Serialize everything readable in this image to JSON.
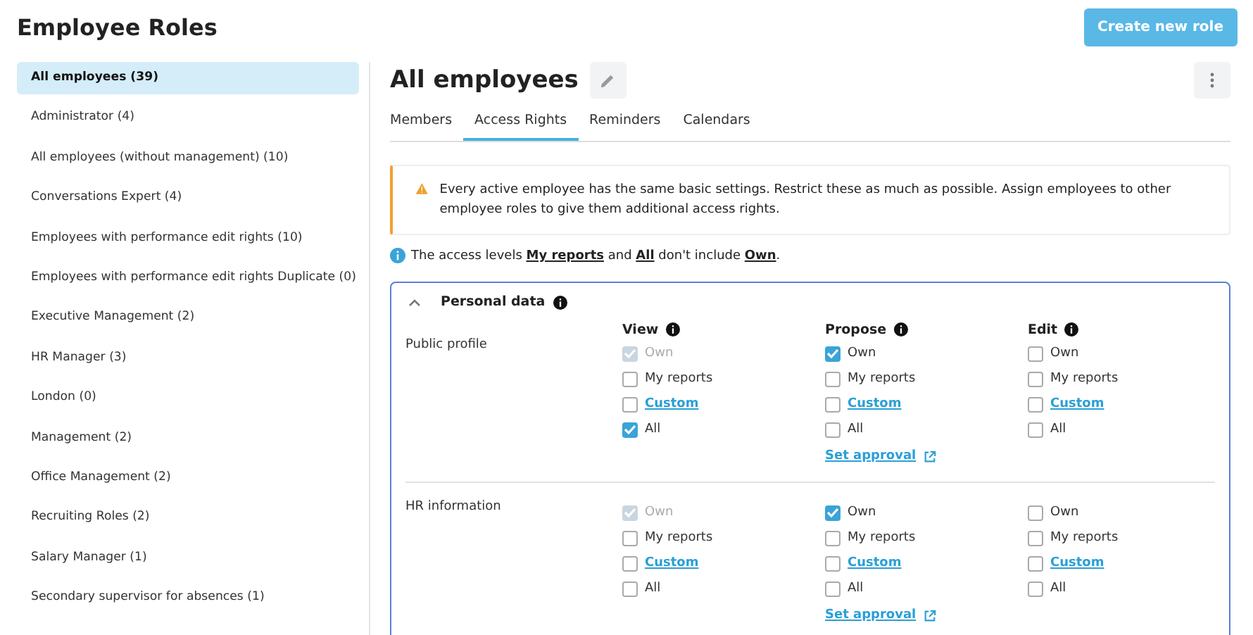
{
  "page_title": "Employee Roles",
  "create_button": "Create new role",
  "sidebar": {
    "items": [
      {
        "label": "All employees (39)",
        "selected": true
      },
      {
        "label": "Administrator (4)",
        "selected": false
      },
      {
        "label": "All employees (without management) (10)",
        "selected": false
      },
      {
        "label": "Conversations Expert (4)",
        "selected": false
      },
      {
        "label": "Employees with performance edit rights (10)",
        "selected": false
      },
      {
        "label": "Employees with performance edit rights Duplicate (0)",
        "selected": false
      },
      {
        "label": "Executive Management (2)",
        "selected": false
      },
      {
        "label": "HR Manager (3)",
        "selected": false
      },
      {
        "label": "London (0)",
        "selected": false
      },
      {
        "label": "Management (2)",
        "selected": false
      },
      {
        "label": "Office Management (2)",
        "selected": false
      },
      {
        "label": "Recruiting Roles (2)",
        "selected": false
      },
      {
        "label": "Salary Manager (1)",
        "selected": false
      },
      {
        "label": "Secondary supervisor for absences (1)",
        "selected": false
      }
    ]
  },
  "role": {
    "title": "All employees"
  },
  "tabs": [
    {
      "label": "Members",
      "selected": false
    },
    {
      "label": "Access Rights",
      "selected": true
    },
    {
      "label": "Reminders",
      "selected": false
    },
    {
      "label": "Calendars",
      "selected": false
    }
  ],
  "warning": "Every active employee has the same basic settings. Restrict these as much as possible. Assign employees to other employee roles to give them additional access rights.",
  "info": "The access levels **My reports** and **All** don't include **Own**.",
  "section": {
    "title": "Personal data",
    "expanded": true,
    "columns": [
      "View",
      "Propose",
      "Edit"
    ],
    "rows": [
      {
        "label": "Public profile",
        "cells": [
          {
            "options": [
              {
                "label": "Own",
                "kind": "plain",
                "checked": true,
                "disabled": true
              },
              {
                "label": "My reports",
                "kind": "plain",
                "checked": false,
                "disabled": false
              },
              {
                "label": "Custom",
                "kind": "link",
                "checked": false,
                "disabled": false
              },
              {
                "label": "All",
                "kind": "plain",
                "checked": true,
                "disabled": false
              }
            ]
          },
          {
            "options": [
              {
                "label": "Own",
                "kind": "plain",
                "checked": true,
                "disabled": false
              },
              {
                "label": "My reports",
                "kind": "plain",
                "checked": false,
                "disabled": false
              },
              {
                "label": "Custom",
                "kind": "link",
                "checked": false,
                "disabled": false
              },
              {
                "label": "All",
                "kind": "plain",
                "checked": false,
                "disabled": false
              }
            ],
            "approval_link": "Set approval"
          },
          {
            "options": [
              {
                "label": "Own",
                "kind": "plain",
                "checked": false,
                "disabled": false
              },
              {
                "label": "My reports",
                "kind": "plain",
                "checked": false,
                "disabled": false
              },
              {
                "label": "Custom",
                "kind": "link",
                "checked": false,
                "disabled": false
              },
              {
                "label": "All",
                "kind": "plain",
                "checked": false,
                "disabled": false
              }
            ]
          }
        ]
      },
      {
        "label": "HR information",
        "cells": [
          {
            "options": [
              {
                "label": "Own",
                "kind": "plain",
                "checked": true,
                "disabled": true
              },
              {
                "label": "My reports",
                "kind": "plain",
                "checked": false,
                "disabled": false
              },
              {
                "label": "Custom",
                "kind": "link",
                "checked": false,
                "disabled": false
              },
              {
                "label": "All",
                "kind": "plain",
                "checked": false,
                "disabled": false
              }
            ]
          },
          {
            "options": [
              {
                "label": "Own",
                "kind": "plain",
                "checked": true,
                "disabled": false
              },
              {
                "label": "My reports",
                "kind": "plain",
                "checked": false,
                "disabled": false
              },
              {
                "label": "Custom",
                "kind": "link",
                "checked": false,
                "disabled": false
              },
              {
                "label": "All",
                "kind": "plain",
                "checked": false,
                "disabled": false
              }
            ],
            "approval_link": "Set approval"
          },
          {
            "options": [
              {
                "label": "Own",
                "kind": "plain",
                "checked": false,
                "disabled": false
              },
              {
                "label": "My reports",
                "kind": "plain",
                "checked": false,
                "disabled": false
              },
              {
                "label": "Custom",
                "kind": "link",
                "checked": false,
                "disabled": false
              },
              {
                "label": "All",
                "kind": "plain",
                "checked": false,
                "disabled": false
              }
            ]
          }
        ]
      }
    ]
  }
}
